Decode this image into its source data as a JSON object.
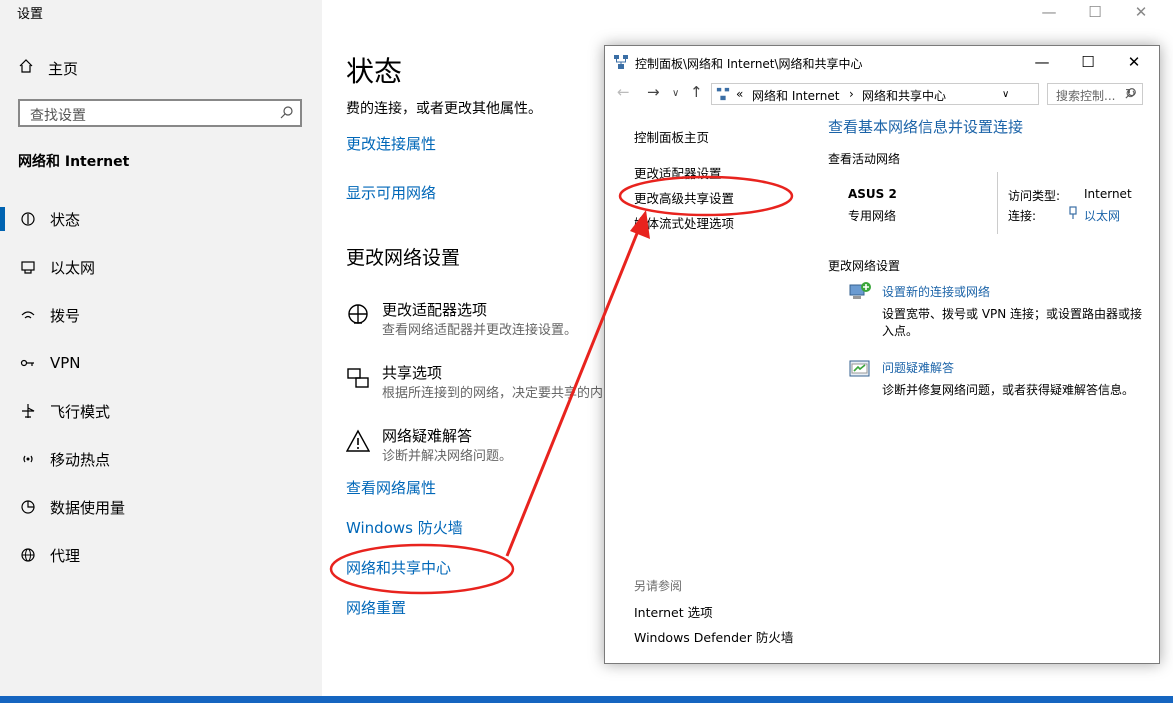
{
  "settings": {
    "app_title": "设置",
    "home_label": "主页",
    "search_placeholder": "查找设置",
    "section": "网络和 Internet",
    "nav": [
      "状态",
      "以太网",
      "拨号",
      "VPN",
      "飞行模式",
      "移动热点",
      "数据使用量",
      "代理"
    ],
    "selected_nav": "状态",
    "window_controls": [
      "—",
      "☐",
      "✕"
    ],
    "main": {
      "title": "状态",
      "desc": "费的连接，或者更改其他属性。",
      "link_change_conn": "更改连接属性",
      "link_show_networks": "显示可用网络",
      "section_title": "更改网络设置",
      "options": [
        {
          "title": "更改适配器选项",
          "desc": "查看网络适配器并更改连接设置。"
        },
        {
          "title": "共享选项",
          "desc": "根据所连接到的网络，决定要共享的内"
        },
        {
          "title": "网络疑难解答",
          "desc": "诊断并解决网络问题。"
        }
      ],
      "link_view_props": "查看网络属性",
      "link_firewall": "Windows 防火墙",
      "link_sharing_center": "网络和共享中心",
      "link_reset": "网络重置"
    }
  },
  "control_panel": {
    "title": "控制面板\\网络和 Internet\\网络和共享中心",
    "address_segments": [
      "«",
      "网络和 Internet",
      "›",
      "网络和共享中心"
    ],
    "search_placeholder": "搜索控制...",
    "left_links": [
      "控制面板主页",
      "更改适配器设置",
      "更改高级共享设置",
      "媒体流式处理选项"
    ],
    "see_also_label": "另请参阅",
    "see_also_links": [
      "Internet 选项",
      "Windows Defender 防火墙"
    ],
    "heading": "查看基本网络信息并设置连接",
    "active_networks_label": "查看活动网络",
    "network_name": "ASUS 2",
    "network_type": "专用网络",
    "access_type_label": "访问类型:",
    "access_type_value": "Internet",
    "connection_label": "连接:",
    "connection_value": "以太网",
    "change_settings_label": "更改网络设置",
    "task1_link": "设置新的连接或网络",
    "task1_desc_line1": "设置宽带、拨号或 VPN 连接；或设置路由器或接",
    "task1_desc_line2": "入点。",
    "task2_link": "问题疑难解答",
    "task2_desc": "诊断并修复网络问题，或者获得疑难解答信息。"
  },
  "colors": {
    "link_blue": "#0067b8",
    "annotation_red": "#e8231e",
    "taskbar_blue": "#1565c0"
  }
}
